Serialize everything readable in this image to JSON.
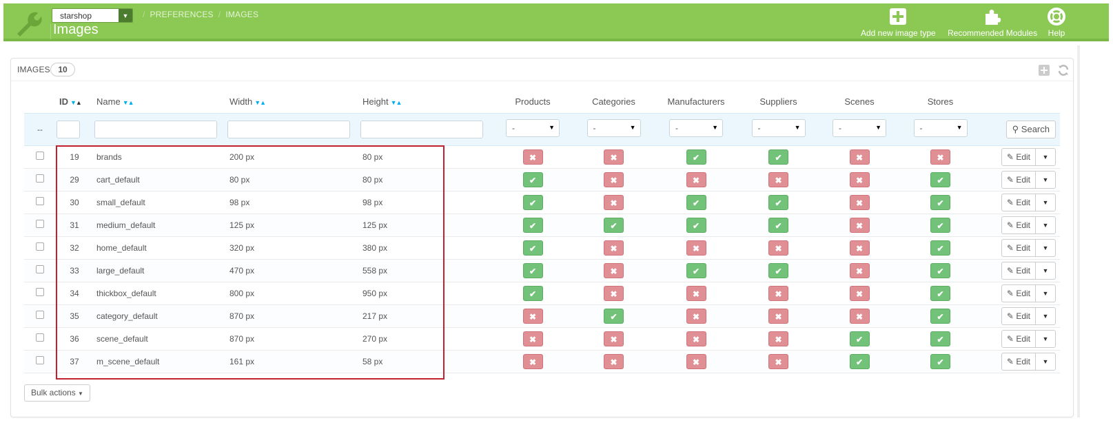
{
  "header": {
    "shop_select": "starshop",
    "breadcrumb": [
      "PREFERENCES",
      "IMAGES"
    ],
    "title": "Images",
    "buttons": [
      {
        "label": "Add new image type",
        "icon": "plus-square-icon"
      },
      {
        "label": "Recommended Modules",
        "icon": "puzzle-icon"
      },
      {
        "label": "Help",
        "icon": "lifebuoy-icon"
      }
    ],
    "colors": {
      "bar": "#8bc954"
    }
  },
  "panel": {
    "title": "IMAGES",
    "count": "10"
  },
  "table": {
    "columns": {
      "id": "ID",
      "name": "Name",
      "width": "Width",
      "height": "Height",
      "products": "Products",
      "categories": "Categories",
      "manufacturers": "Manufacturers",
      "suppliers": "Suppliers",
      "scenes": "Scenes",
      "stores": "Stores"
    },
    "filter": {
      "placeholder": "--",
      "select_value": "-",
      "search_label": "Search"
    },
    "rows": [
      {
        "id": "19",
        "name": "brands",
        "width": "200 px",
        "height": "80 px",
        "flags": [
          false,
          false,
          true,
          true,
          false,
          false
        ]
      },
      {
        "id": "29",
        "name": "cart_default",
        "width": "80 px",
        "height": "80 px",
        "flags": [
          true,
          false,
          false,
          false,
          false,
          true
        ]
      },
      {
        "id": "30",
        "name": "small_default",
        "width": "98 px",
        "height": "98 px",
        "flags": [
          true,
          false,
          true,
          true,
          false,
          true
        ]
      },
      {
        "id": "31",
        "name": "medium_default",
        "width": "125 px",
        "height": "125 px",
        "flags": [
          true,
          true,
          true,
          true,
          false,
          true
        ]
      },
      {
        "id": "32",
        "name": "home_default",
        "width": "320 px",
        "height": "380 px",
        "flags": [
          true,
          false,
          false,
          false,
          false,
          true
        ]
      },
      {
        "id": "33",
        "name": "large_default",
        "width": "470 px",
        "height": "558 px",
        "flags": [
          true,
          false,
          true,
          true,
          false,
          true
        ]
      },
      {
        "id": "34",
        "name": "thickbox_default",
        "width": "800 px",
        "height": "950 px",
        "flags": [
          true,
          false,
          false,
          false,
          false,
          true
        ]
      },
      {
        "id": "35",
        "name": "category_default",
        "width": "870 px",
        "height": "217 px",
        "flags": [
          false,
          true,
          false,
          false,
          false,
          true
        ]
      },
      {
        "id": "36",
        "name": "scene_default",
        "width": "870 px",
        "height": "270 px",
        "flags": [
          false,
          false,
          false,
          false,
          true,
          true
        ]
      },
      {
        "id": "37",
        "name": "m_scene_default",
        "width": "161 px",
        "height": "58 px",
        "flags": [
          false,
          false,
          false,
          false,
          true,
          true
        ]
      }
    ],
    "edit_label": "Edit"
  },
  "footer": {
    "bulk_actions": "Bulk actions"
  }
}
